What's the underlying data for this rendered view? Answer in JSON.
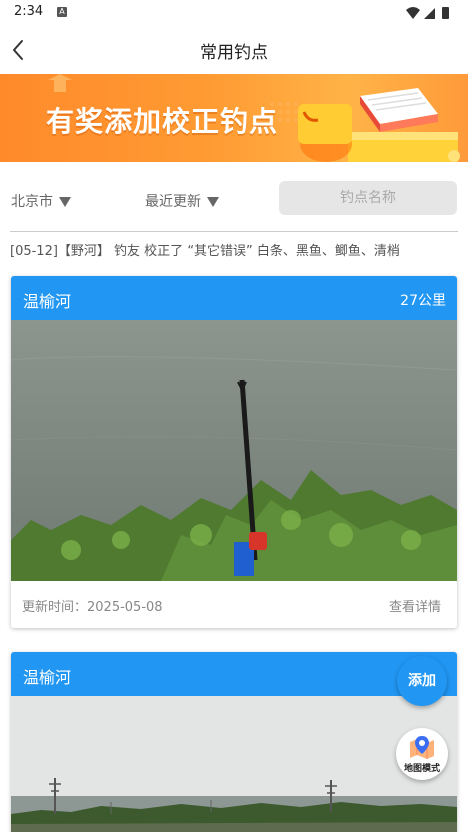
{
  "status_bar": {
    "time": "2:34",
    "notification_glyph": "A"
  },
  "nav": {
    "title": "常用钓点",
    "back_icon": "chevron-left-icon"
  },
  "banner": {
    "text": "有奖添加校正钓点"
  },
  "filters": {
    "city": "北京市",
    "sort": "最近更新",
    "search_placeholder": "钓点名称"
  },
  "ticker": {
    "text": "[05-12]【野河】 钓友 校正了 “其它错误” 白条、黑鱼、鲫鱼、清梢"
  },
  "spots": [
    {
      "name": "温榆河",
      "distance": "27公里",
      "updated": "更新时间：2025-05-08",
      "detail_link": "查看详情"
    },
    {
      "name": "温榆河"
    }
  ],
  "fab": {
    "add_label": "添加",
    "map_label": "地图模式"
  },
  "colors": {
    "accent": "#2196f3",
    "banner": "#ff9b33"
  }
}
